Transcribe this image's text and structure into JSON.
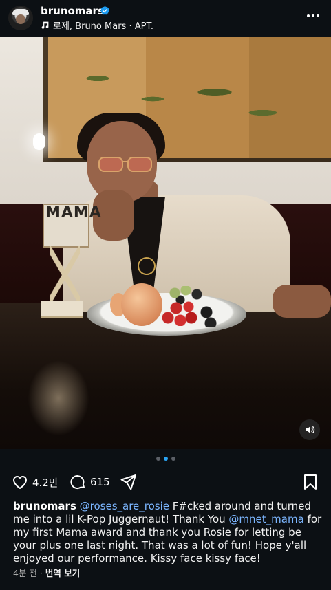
{
  "post": {
    "username": "brunomars",
    "audio_line": "로제, Bruno Mars · APT.",
    "photo_award_text": "MAMA"
  },
  "carousel": {
    "count": 3,
    "active_index": 2
  },
  "actions": {
    "likes": "4.2만",
    "comments": "615"
  },
  "caption": {
    "username": "brunomars",
    "mention_1": "@roses_are_rosie",
    "text_1": " F#cked around and turned me into a lil K-Pop Juggernaut! Thank You ",
    "mention_2": "@mnet_mama",
    "text_2": " for my first Mama award and thank you Rosie for letting be your plus one last night. That was a lot of fun! Hope y'all enjoyed our performance. Kissy face kissy face!"
  },
  "meta": {
    "time_ago": "4분 전",
    "separator": " · ",
    "translate": "번역 보기"
  },
  "icons": {
    "header": [
      "verified-badge-icon",
      "music-note-icon",
      "more-icon"
    ],
    "actions": [
      "heart-icon",
      "comment-icon",
      "share-icon",
      "bookmark-icon"
    ],
    "media": [
      "sound-icon"
    ]
  },
  "colors": {
    "background": "#0c1014",
    "mention": "#7cb6ff",
    "verified": "#1d9bf0",
    "active_dot": "#2aa4f4"
  }
}
